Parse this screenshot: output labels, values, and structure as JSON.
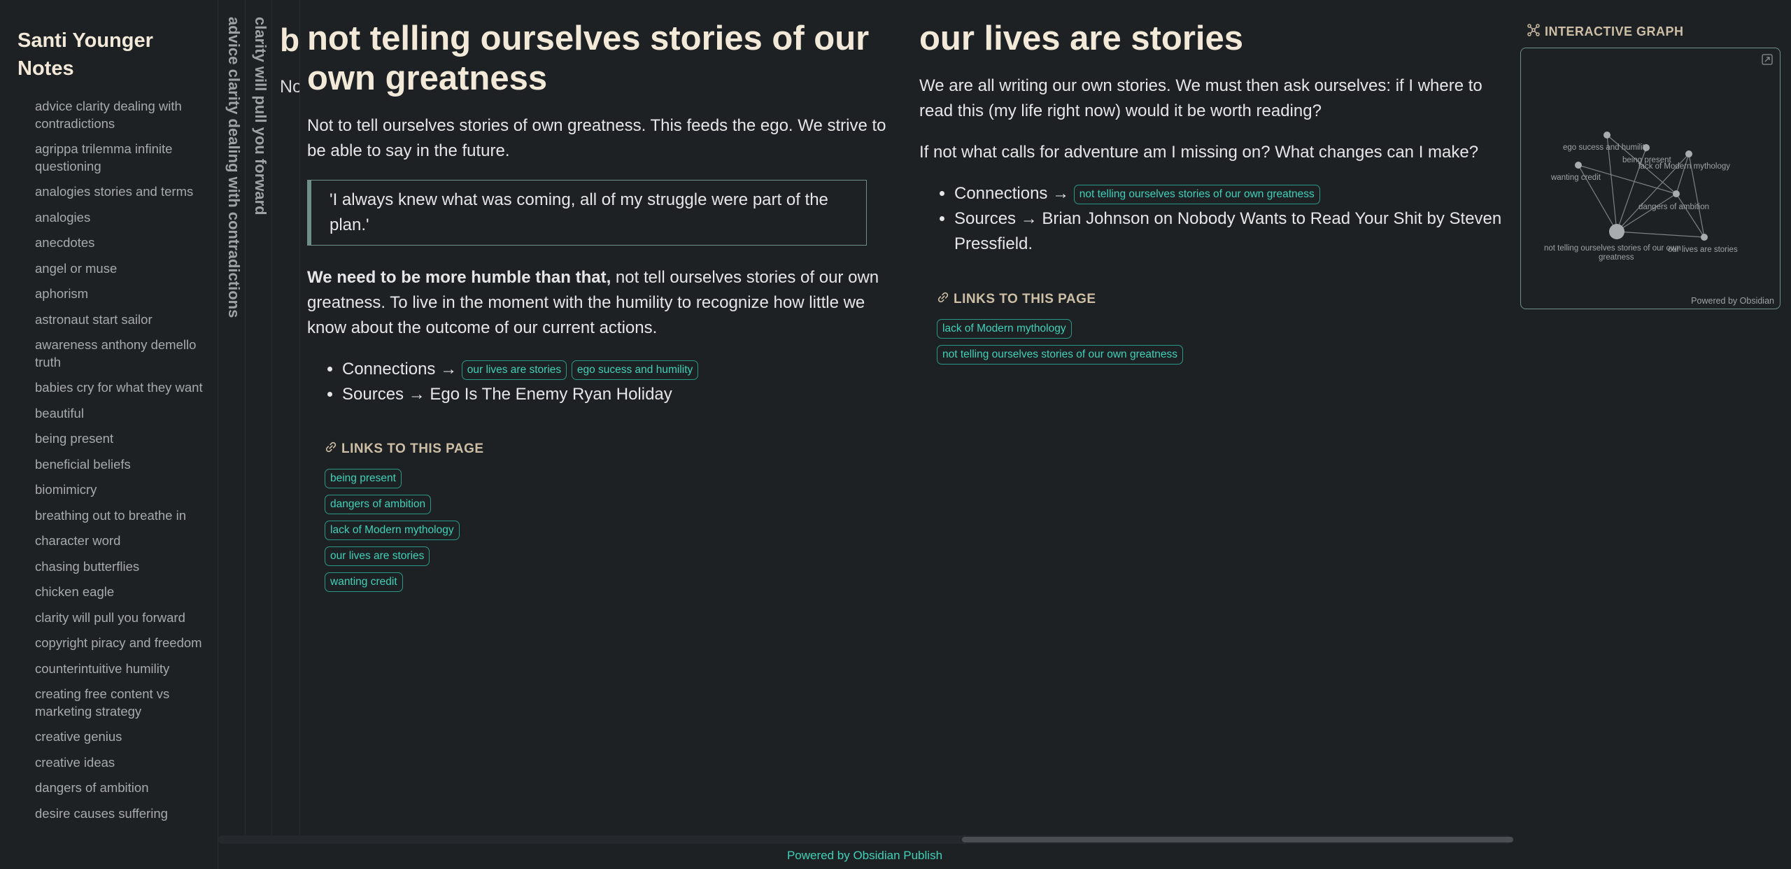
{
  "site": {
    "title": "Santi Younger Notes"
  },
  "sidebar": {
    "items": [
      "advice clarity dealing with contradictions",
      "agrippa trilemma infinite questioning",
      "analogies stories and terms",
      "analogies",
      "anecdotes",
      "angel or muse",
      "aphorism",
      "astronaut start sailor",
      "awareness anthony demello truth",
      "babies cry for what they want",
      "beautiful",
      "being present",
      "beneficial beliefs",
      "biomimicry",
      "breathing out to breathe in",
      "character word",
      "chasing butterflies",
      "chicken eagle",
      "clarity will pull you forward",
      "copyright piracy and freedom",
      "counterintuitive humility",
      "creating free content vs marketing strategy",
      "creative genius",
      "creative ideas",
      "dangers of ambition",
      "desire causes suffering"
    ]
  },
  "stacked": {
    "pane_a": "advice clarity dealing with contradictions",
    "pane_b": "clarity will pull you forward",
    "pane_c_title": "b",
    "pane_c_text": "No"
  },
  "pane1": {
    "title": "not telling ourselves stories of our own greatness",
    "intro": "Not to tell ourselves stories of own greatness. This feeds the ego. We strive to be able to say in the future.",
    "quote": "'I always knew what was coming, all of my struggle were part of the plan.'",
    "bold_lead": "We need to be more humble than that,",
    "body": " not tell ourselves stories of our own greatness. To live in the moment with the humility to recognize how little we know about the outcome of our current actions.",
    "connections_label": "Connections →",
    "connections": [
      "our lives are stories",
      "ego sucess and humility"
    ],
    "sources_label": "Sources → Ego Is The Enemy Ryan Holiday",
    "links_heading": "LINKS TO THIS PAGE",
    "backlinks": [
      "being present",
      "dangers of ambition",
      "lack of Modern mythology",
      "our lives are stories",
      "wanting credit"
    ]
  },
  "pane2": {
    "title": "our lives are stories",
    "para1": "We are all writing our own stories. We must then ask ourselves: if I where to read this (my life right now) would it be worth reading?",
    "para2": "If not what calls for adventure am I missing on? What changes can I make?",
    "connections_label": "Connections →",
    "connections": [
      "not telling ourselves stories of our own greatness"
    ],
    "sources_label": "Sources → Brian Johnson on Nobody Wants to Read Your Shit by Steven Pressfield.",
    "links_heading": "LINKS TO THIS PAGE",
    "backlinks": [
      "lack of Modern mythology",
      "not telling ourselves stories of our own greatness"
    ]
  },
  "graph": {
    "heading": "INTERACTIVE GRAPH",
    "powered": "Powered by Obsidian",
    "nodes": {
      "ego": "ego sucess and humility",
      "being": "being present",
      "lack": "lack of Modern mythology",
      "wanting": "wanting credit",
      "dangers": "dangers of ambition",
      "main_line1": "not telling ourselves stories of our own",
      "main_line2": "greatness",
      "lives": "our lives are stories"
    }
  },
  "footer": {
    "text": "Powered by Obsidian Publish"
  },
  "colors": {
    "accent": "#3fd1b8",
    "heading": "#f2e9d8",
    "background": "#1e2124"
  }
}
